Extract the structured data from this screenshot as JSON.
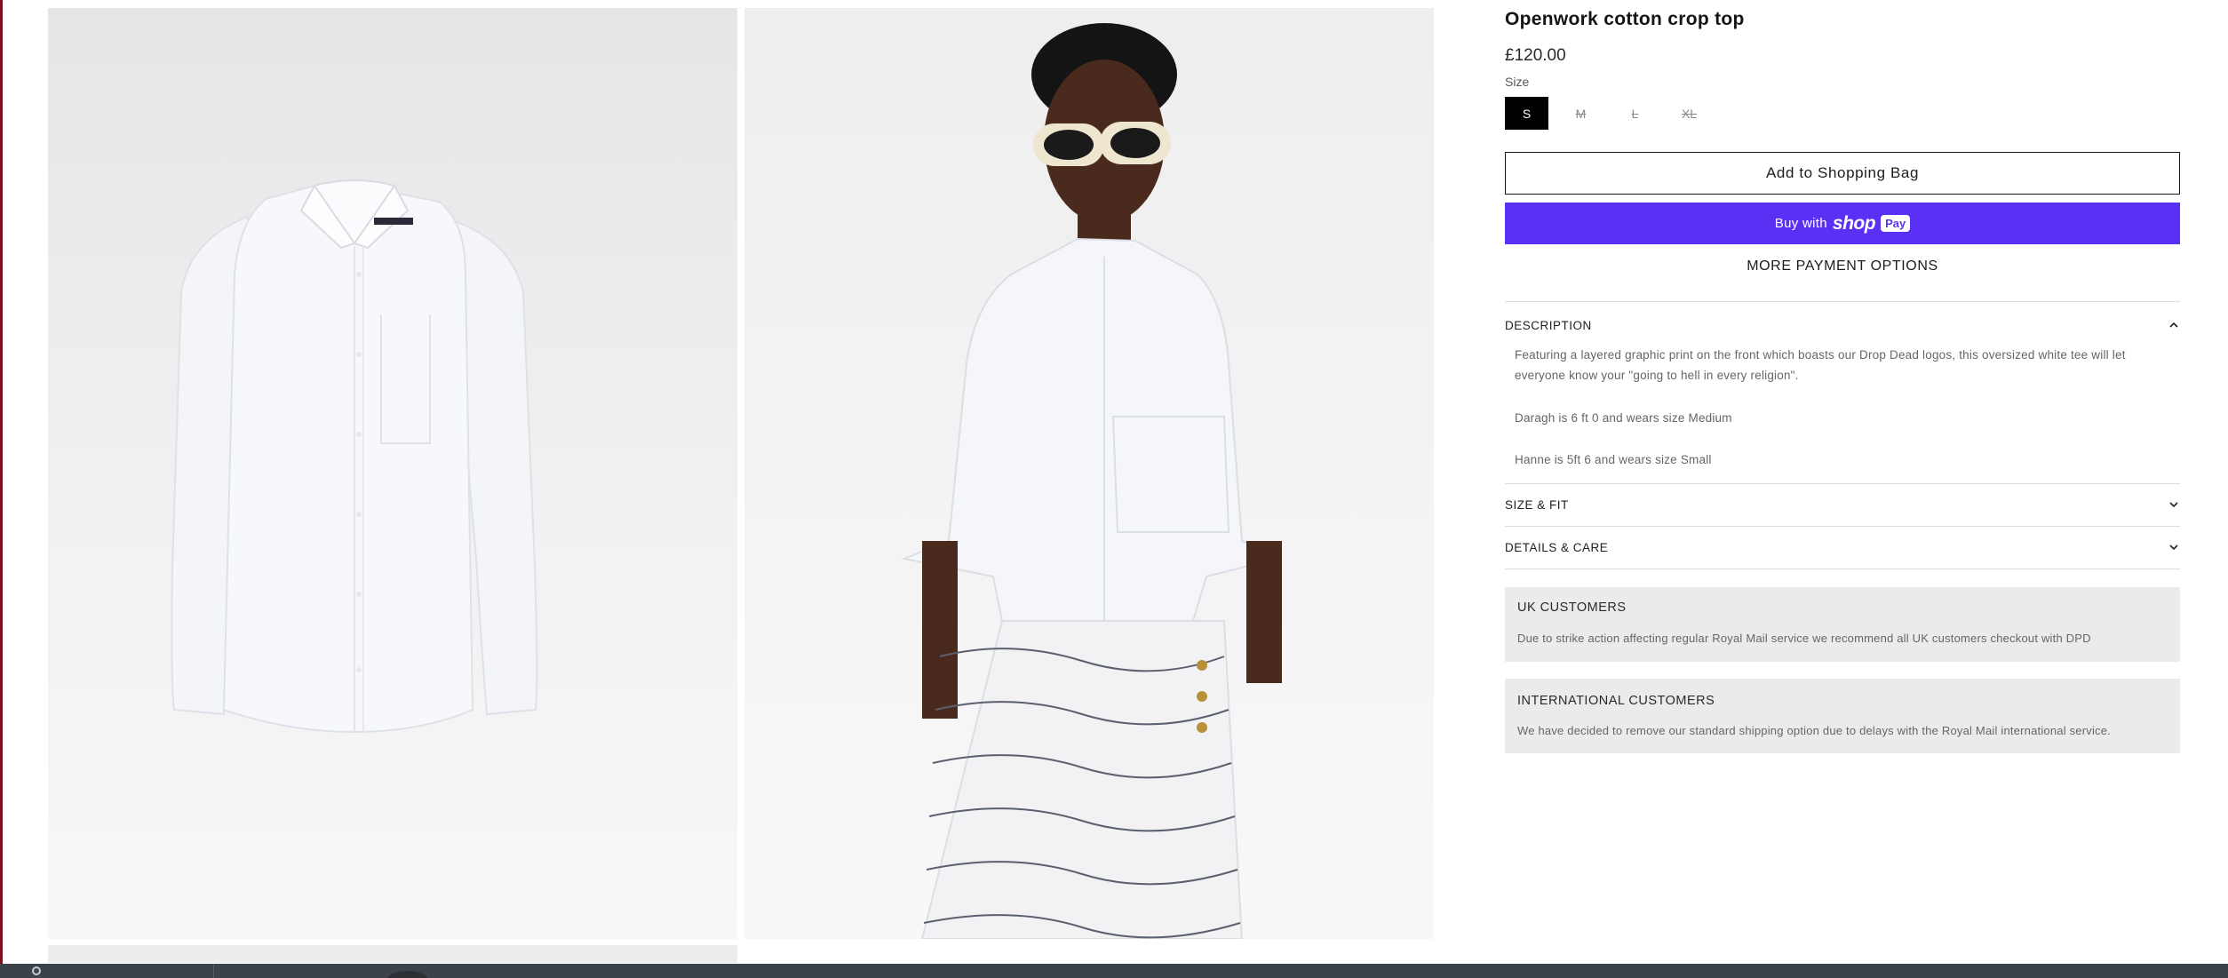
{
  "product": {
    "title": "Openwork cotton crop top",
    "price": "£120.00",
    "size_label": "Size",
    "sizes": [
      {
        "label": "S",
        "selected": true,
        "available": true
      },
      {
        "label": "M",
        "selected": false,
        "available": false
      },
      {
        "label": "L",
        "selected": false,
        "available": false
      },
      {
        "label": "XL",
        "selected": false,
        "available": false
      }
    ]
  },
  "buttons": {
    "add_to_bag": "Add to Shopping Bag",
    "buy_with": "Buy with",
    "shop_word": "shop",
    "pay_pill": "Pay",
    "more_payment": "MORE PAYMENT OPTIONS"
  },
  "accordion": {
    "description": {
      "title": "DESCRIPTION",
      "expanded": true,
      "paragraphs": [
        "Featuring a layered graphic print on the front which boasts our Drop Dead logos, this oversized white tee will let everyone know your \"going to hell in every religion\".",
        "Daragh is 6 ft 0 and wears size Medium",
        "Hanne is 5ft 6 and wears size Small"
      ]
    },
    "size_fit": {
      "title": "SIZE & FIT",
      "expanded": false
    },
    "details_care": {
      "title": "DETAILS & CARE",
      "expanded": false
    }
  },
  "notices": [
    {
      "title": "UK CUSTOMERS",
      "body": "Due to strike action affecting regular Royal Mail service we recommend all UK customers checkout with DPD"
    },
    {
      "title": "INTERNATIONAL CUSTOMERS",
      "body": "We have decided to remove our standard shipping option due to delays with the Royal Mail international service."
    }
  ],
  "gallery": [
    {
      "image": "white-shirt-flat-lay"
    },
    {
      "image": "model-in-white-shirt-and-printed-trousers"
    },
    {
      "image": "gallery-next-image"
    }
  ],
  "colors": {
    "shop_pay": "#5a31f4",
    "selected_size": "#000000",
    "notice_bg": "#ebebeb"
  }
}
